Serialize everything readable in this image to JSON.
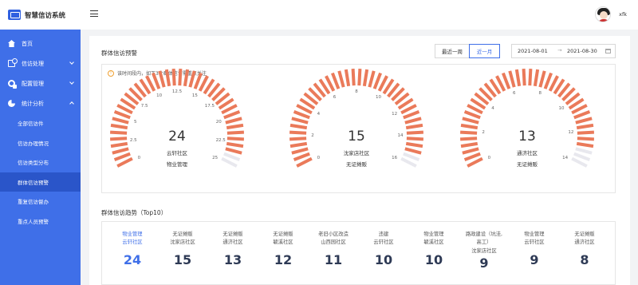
{
  "app": {
    "title": "智慧信访系统"
  },
  "user": {
    "name": "xfk"
  },
  "sidebar": {
    "items": [
      {
        "label": "首页",
        "icon": "home-icon"
      },
      {
        "label": "信访处理",
        "icon": "document-icon",
        "expanded": false
      },
      {
        "label": "配置管理",
        "icon": "config-icon",
        "expanded": false
      },
      {
        "label": "统计分析",
        "icon": "pie-chart-icon",
        "expanded": true
      }
    ],
    "sub_items": [
      "全部信访件",
      "信访办理情况",
      "信访类型分布",
      "群体信访预警",
      "重复信访督办",
      "重点人员预警"
    ],
    "active_sub": "群体信访预警"
  },
  "warning": {
    "title": "群体信访预警",
    "period_buttons": [
      "最近一周",
      "近一月"
    ],
    "active_period": "近一月",
    "date_start": "2021-08-01",
    "date_end": "2021-08-30",
    "notice": "该时间段内，如下3个群体信访需重点关注"
  },
  "gauges": [
    {
      "value": "24",
      "community": "云轩社区",
      "type": "物业管理",
      "max": 25,
      "ticks": [
        "0",
        "2.5",
        "5",
        "7.5",
        "10",
        "12.5",
        "15",
        "17.5",
        "20",
        "22.5",
        "25"
      ]
    },
    {
      "value": "15",
      "community": "沈家店社区",
      "type": "无证摊贩",
      "max": 16,
      "ticks": [
        "0",
        "2",
        "4",
        "6",
        "8",
        "10",
        "12",
        "14",
        "16"
      ]
    },
    {
      "value": "13",
      "community": "通济社区",
      "type": "无证摊贩",
      "max": 14,
      "ticks": [
        "0",
        "2",
        "4",
        "6",
        "8",
        "10",
        "12",
        "14"
      ]
    }
  ],
  "trend": {
    "title": "群体信访趋势（Top10）",
    "items": [
      {
        "l1": "物业管理",
        "l2": "云轩社区",
        "l3": "",
        "count": "24"
      },
      {
        "l1": "无证摊贩",
        "l2": "沈家店社区",
        "l3": "",
        "count": "15"
      },
      {
        "l1": "无证摊贩",
        "l2": "通济社区",
        "l3": "",
        "count": "13"
      },
      {
        "l1": "无证摊贩",
        "l2": "毓溪社区",
        "l3": "",
        "count": "12"
      },
      {
        "l1": "老旧小区改造",
        "l2": "山西园社区",
        "l3": "",
        "count": "11"
      },
      {
        "l1": "违建",
        "l2": "云轩社区",
        "l3": "",
        "count": "10"
      },
      {
        "l1": "物业管理",
        "l2": "毓溪社区",
        "l3": "",
        "count": "10"
      },
      {
        "l1": "路政建设（坑洼,",
        "l2": "高工）",
        "l3": "沈家店社区",
        "count": "9"
      },
      {
        "l1": "物业管理",
        "l2": "云轩社区",
        "l3": "",
        "count": "9"
      },
      {
        "l1": "无证摊贩",
        "l2": "通济社区",
        "l3": "",
        "count": "8"
      }
    ]
  },
  "colors": {
    "primary": "#3f6fe8",
    "gauge_fill": "#ea7a5a",
    "gauge_empty": "#e8e8ee"
  }
}
